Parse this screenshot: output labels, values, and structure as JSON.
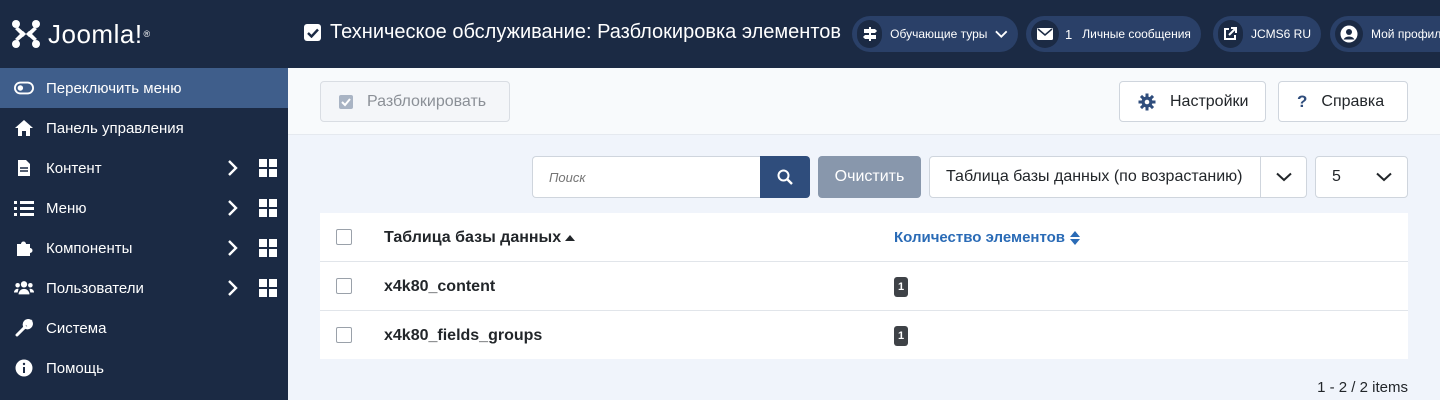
{
  "app": {
    "logo_text": "Joomla!",
    "logo_mark": "®"
  },
  "sidebar": {
    "items": [
      {
        "label": "Переключить меню",
        "icon": "toggle-icon"
      },
      {
        "label": "Панель управления",
        "icon": "home-icon"
      },
      {
        "label": "Контент",
        "icon": "file-icon"
      },
      {
        "label": "Меню",
        "icon": "list-icon"
      },
      {
        "label": "Компоненты",
        "icon": "puzzle-icon"
      },
      {
        "label": "Пользователи",
        "icon": "users-icon"
      },
      {
        "label": "Система",
        "icon": "wrench-icon"
      },
      {
        "label": "Помощь",
        "icon": "info-icon"
      }
    ]
  },
  "header": {
    "title": "Техническое обслуживание: Разблокировка элементов",
    "tours": "Обучающие туры",
    "messages_count": "1",
    "messages": "Личные сообщения",
    "site": "JCMS6 RU",
    "profile": "Мой профиль"
  },
  "toolbar": {
    "unlock": "Разблокировать",
    "options": "Настройки",
    "help": "Справка"
  },
  "filters": {
    "search_placeholder": "Поиск",
    "clear": "Очистить",
    "sort": "Таблица базы данных (по возрастанию)",
    "limit": "5"
  },
  "table": {
    "columns": [
      "Таблица базы данных",
      "Количество элементов"
    ],
    "rows": [
      {
        "name": "x4k80_content",
        "count": "1"
      },
      {
        "name": "x4k80_fields_groups",
        "count": "1"
      }
    ]
  },
  "pagination": "1 - 2 / 2 items",
  "colors": {
    "sidebar": "#1b2a44",
    "active": "#3f5e8b",
    "primary": "#2f4d7c",
    "link": "#2a6bb6"
  }
}
